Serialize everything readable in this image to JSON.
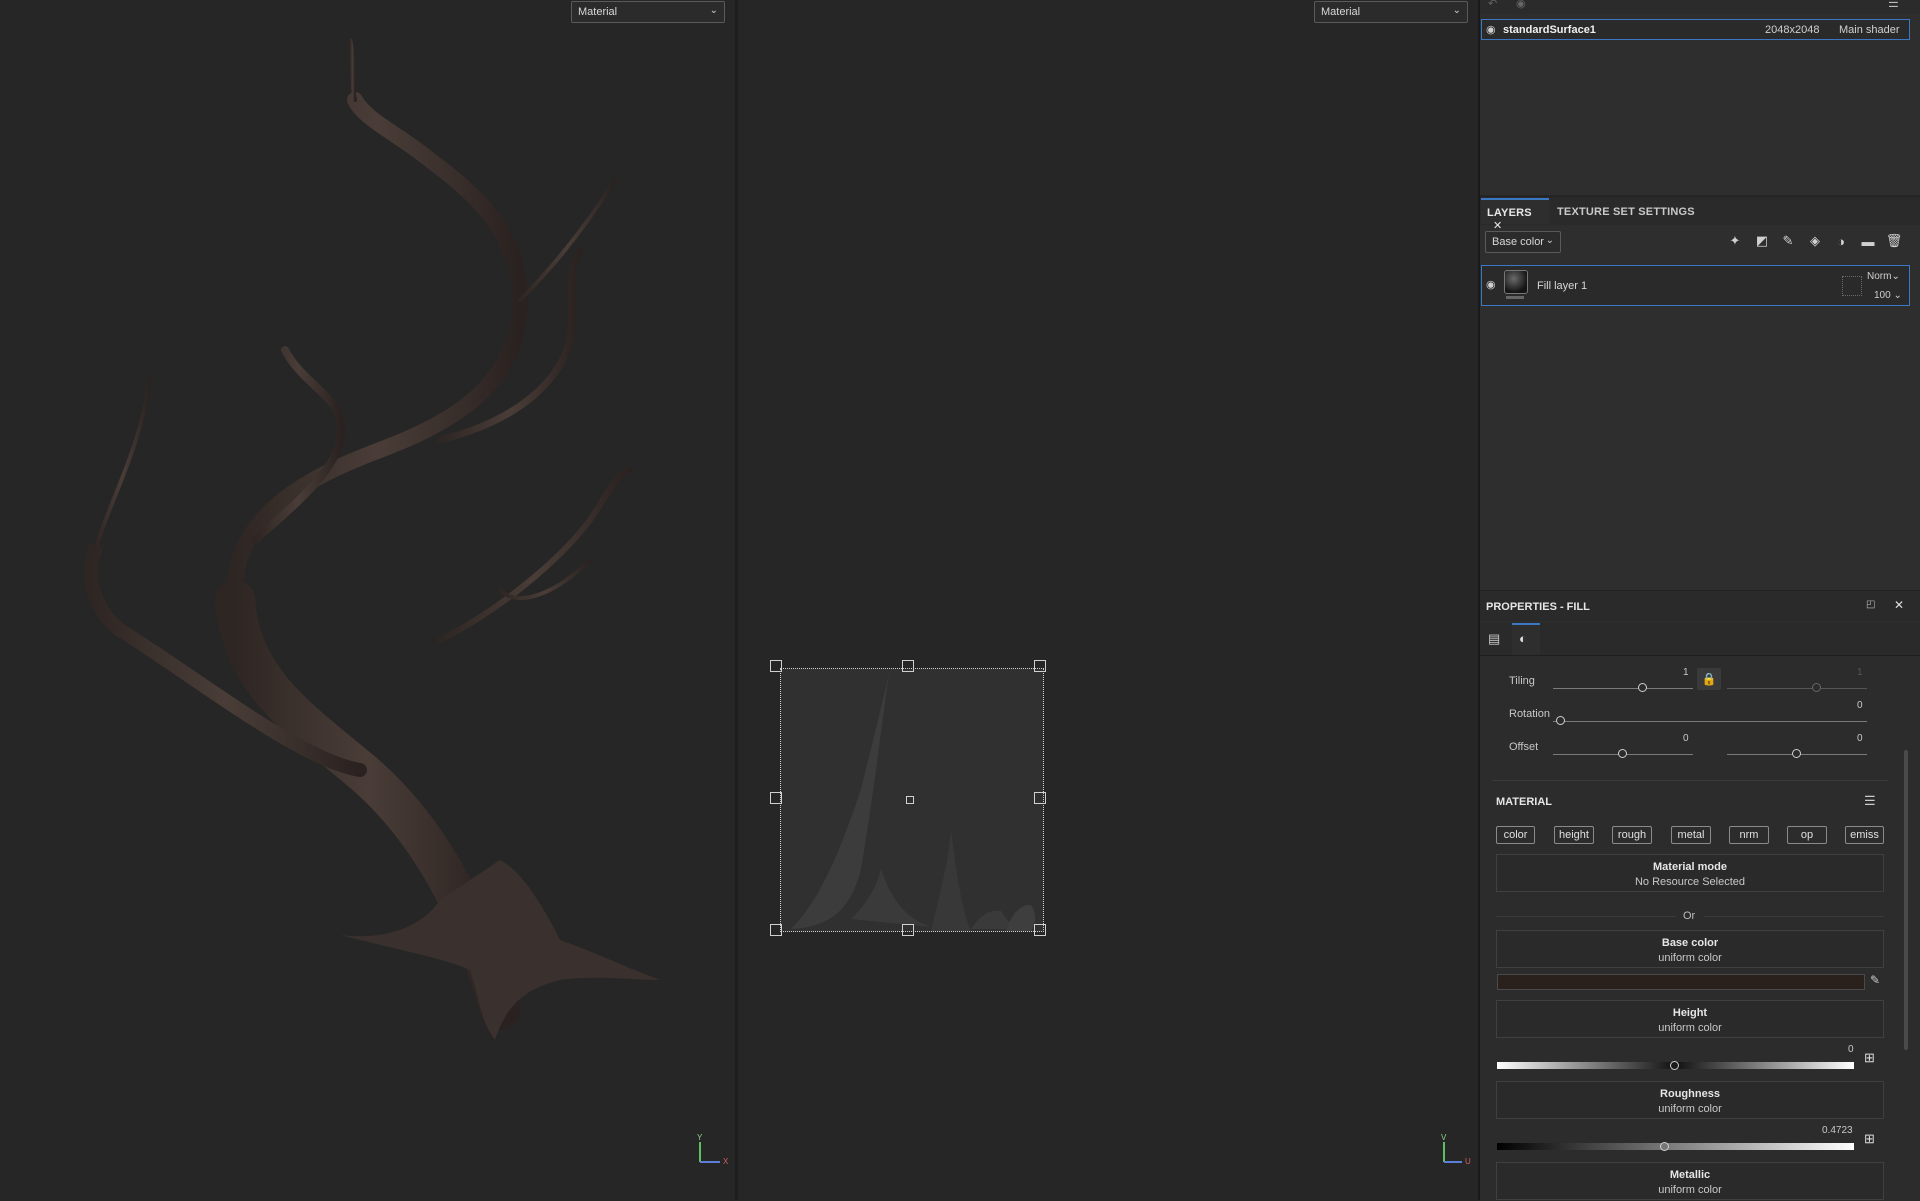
{
  "viewports": {
    "left_dropdown": "Material",
    "right_dropdown": "Material",
    "axis_3d": {
      "y": "Y",
      "x": "X"
    },
    "axis_2d": {
      "v": "V",
      "u": "U"
    }
  },
  "texture_set": {
    "name": "standardSurface1",
    "resolution": "2048x2048",
    "shader": "Main shader"
  },
  "layers_panel": {
    "tab_layers": "LAYERS",
    "tab_texture_set": "TEXTURE SET SETTINGS",
    "channel_dropdown": "Base color",
    "layer": {
      "name": "Fill layer 1",
      "blend": "Norm",
      "opacity": "100"
    }
  },
  "properties": {
    "title": "PROPERTIES - FILL",
    "tiling": {
      "label": "Tiling",
      "value": "1",
      "value2": "1"
    },
    "rotation": {
      "label": "Rotation",
      "value": "0"
    },
    "offset": {
      "label": "Offset",
      "value_u": "0",
      "value_v": "0"
    },
    "material_header": "MATERIAL",
    "channels": [
      "color",
      "height",
      "rough",
      "metal",
      "nrm",
      "op",
      "emiss"
    ],
    "material_mode": {
      "title": "Material mode",
      "subtitle": "No Resource Selected"
    },
    "or_label": "Or",
    "base_color": {
      "title": "Base color",
      "subtitle": "uniform color",
      "swatch": "#2a211d"
    },
    "height": {
      "title": "Height",
      "subtitle": "uniform color",
      "value": "0"
    },
    "roughness": {
      "title": "Roughness",
      "subtitle": "uniform color",
      "value": "0.4723"
    },
    "metallic": {
      "title": "Metallic",
      "subtitle": "uniform color"
    }
  },
  "colors": {
    "accent": "#3a78c4",
    "panel": "#2c2c2c",
    "viewport": "#262626"
  }
}
